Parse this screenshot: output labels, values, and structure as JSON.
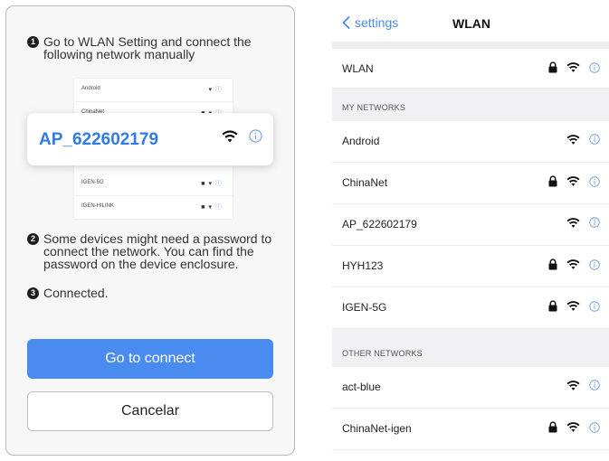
{
  "dialog": {
    "step1": {
      "num": "1",
      "text": "Go to WLAN Setting and connect the following network manually"
    },
    "mini_list": [
      {
        "name": "Android",
        "lock": false
      },
      {
        "name": "ChinaNet",
        "lock": true
      },
      {
        "name": "IGEN-5G",
        "lock": true
      },
      {
        "name": "IGEN-HILINK",
        "lock": true
      }
    ],
    "popup_network": "AP_622602179",
    "step2": {
      "num": "2",
      "text": "Some devices might need a password to connect the network. You can find the password on the device enclosure."
    },
    "step3": {
      "num": "3",
      "text": "Connected."
    },
    "connect_button": "Go to connect",
    "cancel_button": "Cancelar"
  },
  "settings": {
    "back_label": "settings",
    "title": "WLAN",
    "wlan_label": "WLAN",
    "my_networks_header": "MY NETWORKS",
    "my_networks": [
      {
        "name": "Android",
        "lock": false
      },
      {
        "name": "ChinaNet",
        "lock": true
      },
      {
        "name": "AP_622602179",
        "lock": false
      },
      {
        "name": "HYH123",
        "lock": true
      },
      {
        "name": "IGEN-5G",
        "lock": true
      }
    ],
    "other_networks_header": "OTHER NETWORKS",
    "other_networks": [
      {
        "name": "act-blue",
        "lock": false
      },
      {
        "name": "ChinaNet-igen",
        "lock": true
      }
    ]
  },
  "colors": {
    "accent": "#4a8bf0",
    "network_highlight": "#2f7be8",
    "info_icon": "#6f9ee0"
  }
}
